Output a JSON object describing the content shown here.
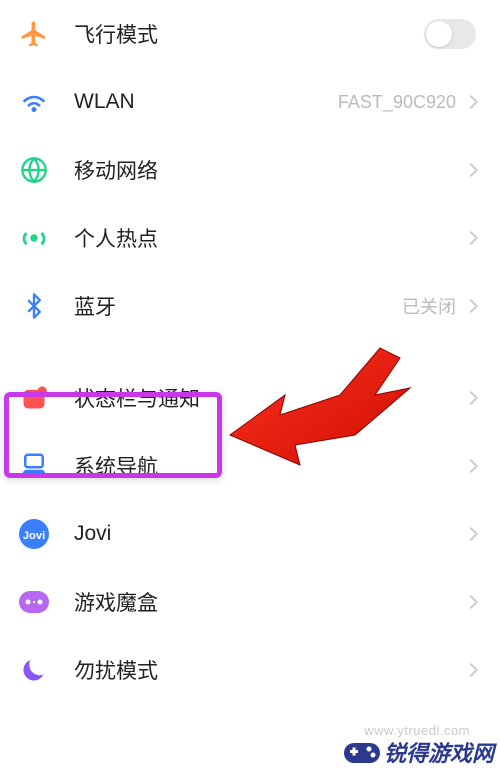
{
  "settings": {
    "airplane": {
      "label": "飞行模式"
    },
    "wlan": {
      "label": "WLAN",
      "value": "FAST_90C920"
    },
    "mobile": {
      "label": "移动网络"
    },
    "hotspot": {
      "label": "个人热点"
    },
    "bluetooth": {
      "label": "蓝牙",
      "value": "已关闭"
    },
    "statusbar": {
      "label": "状态栏与通知"
    },
    "navigation": {
      "label": "系统导航"
    },
    "jovi": {
      "label": "Jovi"
    },
    "gamebox": {
      "label": "游戏魔盒"
    },
    "dnd": {
      "label": "勿扰模式"
    }
  },
  "watermark": {
    "brand": "锐得游戏网",
    "url": "www.ytruedl.com"
  }
}
